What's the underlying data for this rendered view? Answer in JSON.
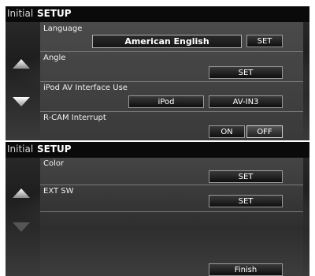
{
  "screen1": {
    "header": {
      "initial": "Initial",
      "setup": "SETUP"
    },
    "rows": [
      {
        "label": "Language",
        "value": "American English",
        "set": "SET"
      },
      {
        "label": "Angle",
        "set": "SET"
      },
      {
        "label": "iPod AV Interface Use",
        "option_a": "iPod",
        "option_b": "AV-IN3"
      },
      {
        "label": "R-CAM Interrupt",
        "on": "ON",
        "off": "OFF",
        "selected": "OFF"
      }
    ],
    "nav": {
      "up_icon": "triangle-up",
      "down_icon": "triangle-down"
    }
  },
  "screen2": {
    "header": {
      "initial": "Initial",
      "setup": "SETUP"
    },
    "rows": [
      {
        "label": "Color",
        "set": "SET"
      },
      {
        "label": "EXT SW",
        "set": "SET"
      }
    ],
    "finish": "Finish",
    "nav": {
      "up_icon": "triangle-up",
      "down_icon": "triangle-down-disabled"
    }
  },
  "colors": {
    "background": "#1e1e1e",
    "panel": "#404040",
    "text": "#ffffff",
    "button_border": "#9a9a9a"
  }
}
